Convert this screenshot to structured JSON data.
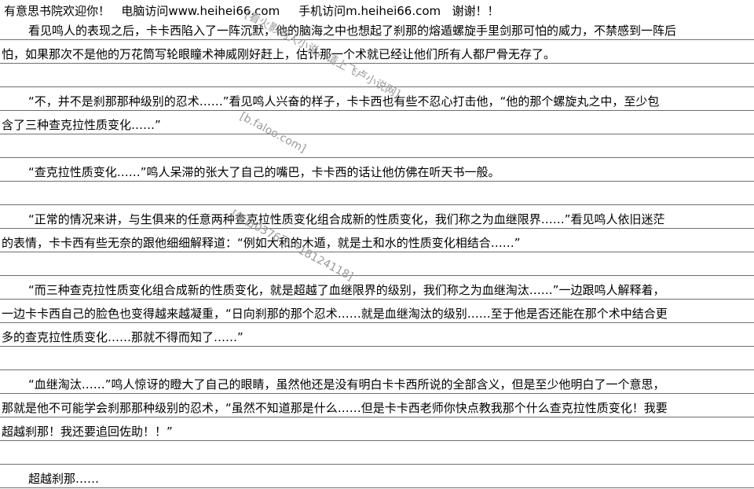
{
  "header": {
    "welcome": "有意思书院欢迎你！",
    "pc_label": "电脑访问www.heihei66.com",
    "mobile_label": "手机访问m.heihei66.com",
    "thanks": "谢谢！！"
  },
  "lines": [
    "看见鸣人的表现之后，卡卡西陷入了一阵沉默，他的脑海之中也想起了刹那的熔遁螺旋手里剑那可怕的威力，不禁感到一阵后",
    "怕，如果那次不是他的万花筒写轮眼瞳术神威刚好赶上，估计那一个术就已经让他们所有人都尸骨无存了。",
    "",
    "“不，并不是刹那那种级别的忍术……”看见鸣人兴奋的样子，卡卡西也有些不忍心打击他，“他的那个螺旋丸之中，至少包",
    "含了三种查克拉性质变化……”",
    "",
    "“查克拉性质变化……”鸣人呆滞的张大了自己的嘴巴，卡卡西的话让他仿佛在听天书一般。",
    "",
    "“正常的情况来讲，与生俱来的任意两种查克拉性质变化组合成新的性质变化，我们称之为血继限界……”看见鸣人依旧迷茫",
    "的表情，卡卡西有些无奈的跟他细细解释道：“例如大和的木遁，就是土和水的性质变化相结合……”",
    "",
    "“而三种查克拉性质变化组合成新的性质变化，就是超越了血继限界的级别，我们称之为血继淘汰……”一边跟鸣人解释着，",
    "一边卡卡西自己的脸色也变得越来越凝重，“日向刹那的那个忍术……就是血继淘汰的级别……至于他是否还能在那个术中结合更",
    "多的查克拉性质变化……那就不得而知了……”",
    "",
    "“血继淘汰……”鸣人惊讶的瞪大了自己的眼睛，虽然他还是没有明白卡卡西所说的全部含义，但是至少他明白了一个意思，",
    "那就是他不可能学会刹那那种级别的忍术，“虽然不知道那是什么……但是卡卡西老师你快点教我那个什么查克拉性质变化！我要",
    "超越刹那！我还要追回佐助！！”",
    "",
    "超越刹那……"
  ],
  "watermarks": {
    "wm1": "[看火影同人小说，请上飞卢小说网]",
    "wm2": "[b.faloo.com]",
    "wm3": "[每日0376飞卢18124118]"
  }
}
